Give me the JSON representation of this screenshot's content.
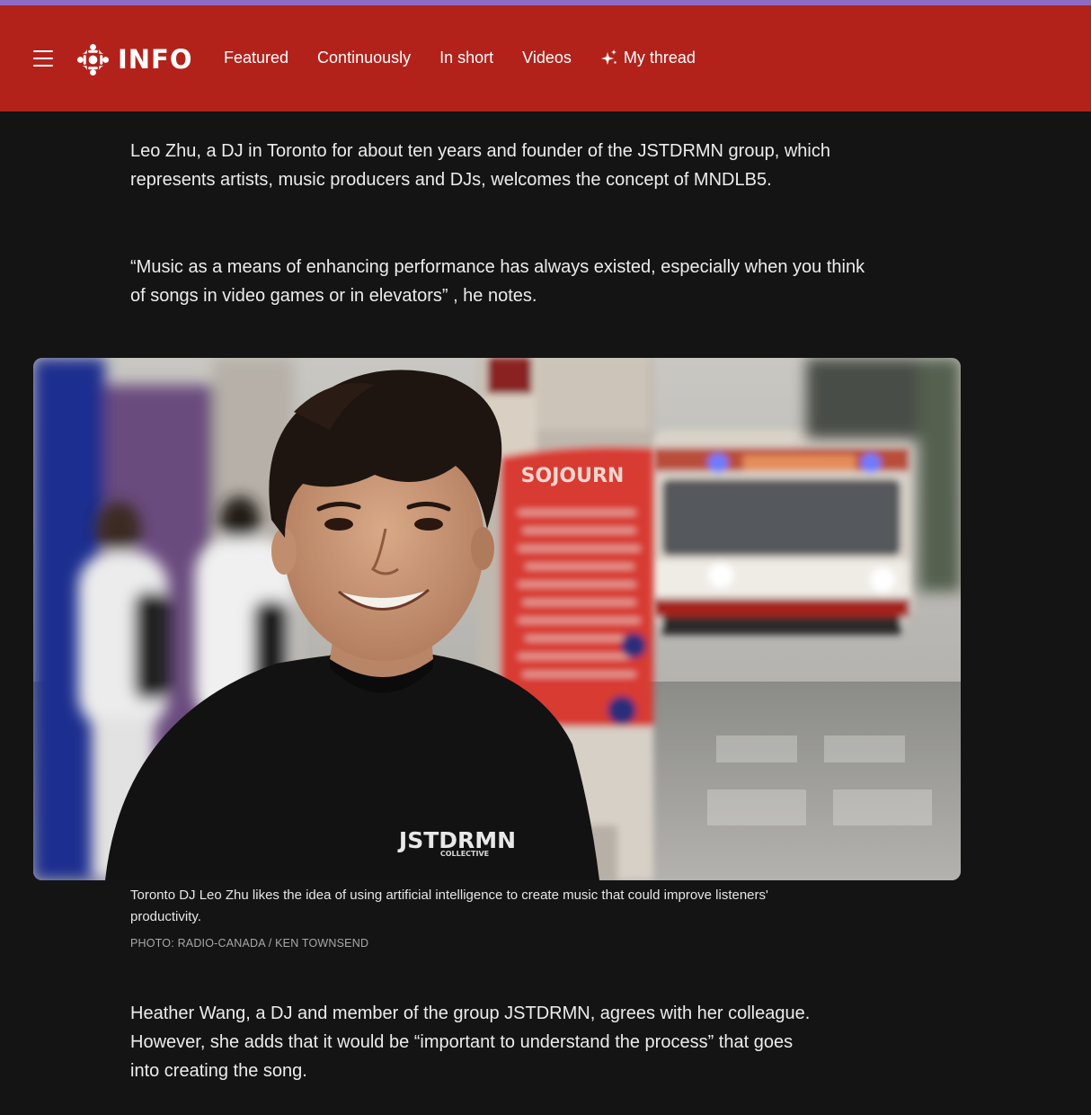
{
  "header": {
    "menu_icon": "hamburger-menu-icon",
    "brand_icon": "radio-canada-gem-icon",
    "brand_label": "INFO",
    "nav": [
      {
        "label": "Featured"
      },
      {
        "label": "Continuously"
      },
      {
        "label": "In short"
      },
      {
        "label": "Videos"
      },
      {
        "label": "My thread",
        "icon": "sparkle-icon"
      }
    ],
    "colors": {
      "accent_bar": "#8e6cc4",
      "header_bg": "#b2221b"
    }
  },
  "article": {
    "paragraphs": [
      "Leo Zhu, a DJ in Toronto for about ten years and founder of the JSTDRMN group, which represents artists, music producers and DJs, welcomes the concept of MNDLB5.",
      "“Music as a means of enhancing performance has always existed, especially when you think of songs in video games or in elevators” , he notes.",
      "Heather Wang, a DJ and member of the group JSTDRMN, agrees with her colleague. However, she adds that it would be “important to understand the process” that goes into creating the song."
    ],
    "figure": {
      "shirt_text": "JSTDRMN",
      "shirt_subtext": "COLLECTIVE",
      "poster_text": "SOJOURN",
      "caption": "Toronto DJ Leo Zhu likes the idea of using artificial intelligence to create music that could improve listeners' productivity.",
      "credit": "PHOTO: RADIO-CANADA / KEN TOWNSEND"
    },
    "colors": {
      "page_bg": "#141414",
      "text": "#ececec"
    }
  }
}
